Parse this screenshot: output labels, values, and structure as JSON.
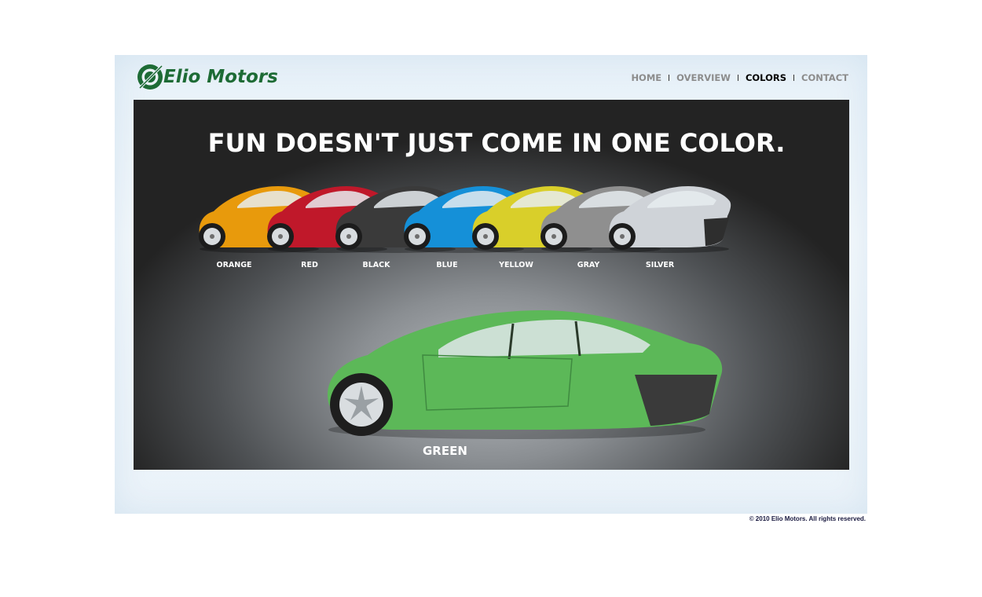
{
  "brand": {
    "name": "Elio Motors",
    "accent": "#1d6b35"
  },
  "nav": {
    "items": [
      {
        "label": "HOME",
        "active": false
      },
      {
        "label": "OVERVIEW",
        "active": false
      },
      {
        "label": "COLORS",
        "active": true
      },
      {
        "label": "CONTACT",
        "active": false
      }
    ]
  },
  "hero": {
    "headline": "FUN DOESN'T JUST COME IN ONE COLOR.",
    "colors": [
      {
        "label": "ORANGE",
        "hex": "#e89a0c"
      },
      {
        "label": "RED",
        "hex": "#c0182a"
      },
      {
        "label": "BLACK",
        "hex": "#3a3a3a"
      },
      {
        "label": "BLUE",
        "hex": "#1590d8"
      },
      {
        "label": "YELLOW",
        "hex": "#d9cf2a"
      },
      {
        "label": "GRAY",
        "hex": "#8f8f8f"
      },
      {
        "label": "SILVER",
        "hex": "#cfd3d8"
      }
    ],
    "featured": {
      "label": "GREEN",
      "hex": "#5cb858"
    }
  },
  "footer": {
    "copyright": "© 2010 Elio Motors.  All rights reserved."
  }
}
